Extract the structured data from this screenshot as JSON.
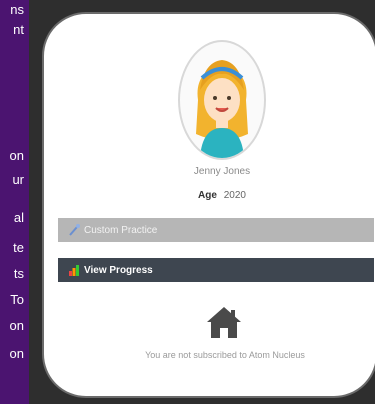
{
  "left_text": [
    "ns",
    "nt",
    "on",
    "ur",
    "al",
    "te",
    "ts",
    "To",
    "on",
    "on"
  ],
  "profile": {
    "name": "Jenny Jones",
    "age_label": "Age",
    "age_value": "2020"
  },
  "buttons": {
    "custom_practice": "Custom Practice",
    "view_progress": "View Progress"
  },
  "subscription_message": "You are not subscribed to Atom Nucleus",
  "colors": {
    "page_bg": "#4b1470",
    "custom_practice_bg": "#b6b6b6",
    "view_progress_bg": "#3e4650"
  }
}
